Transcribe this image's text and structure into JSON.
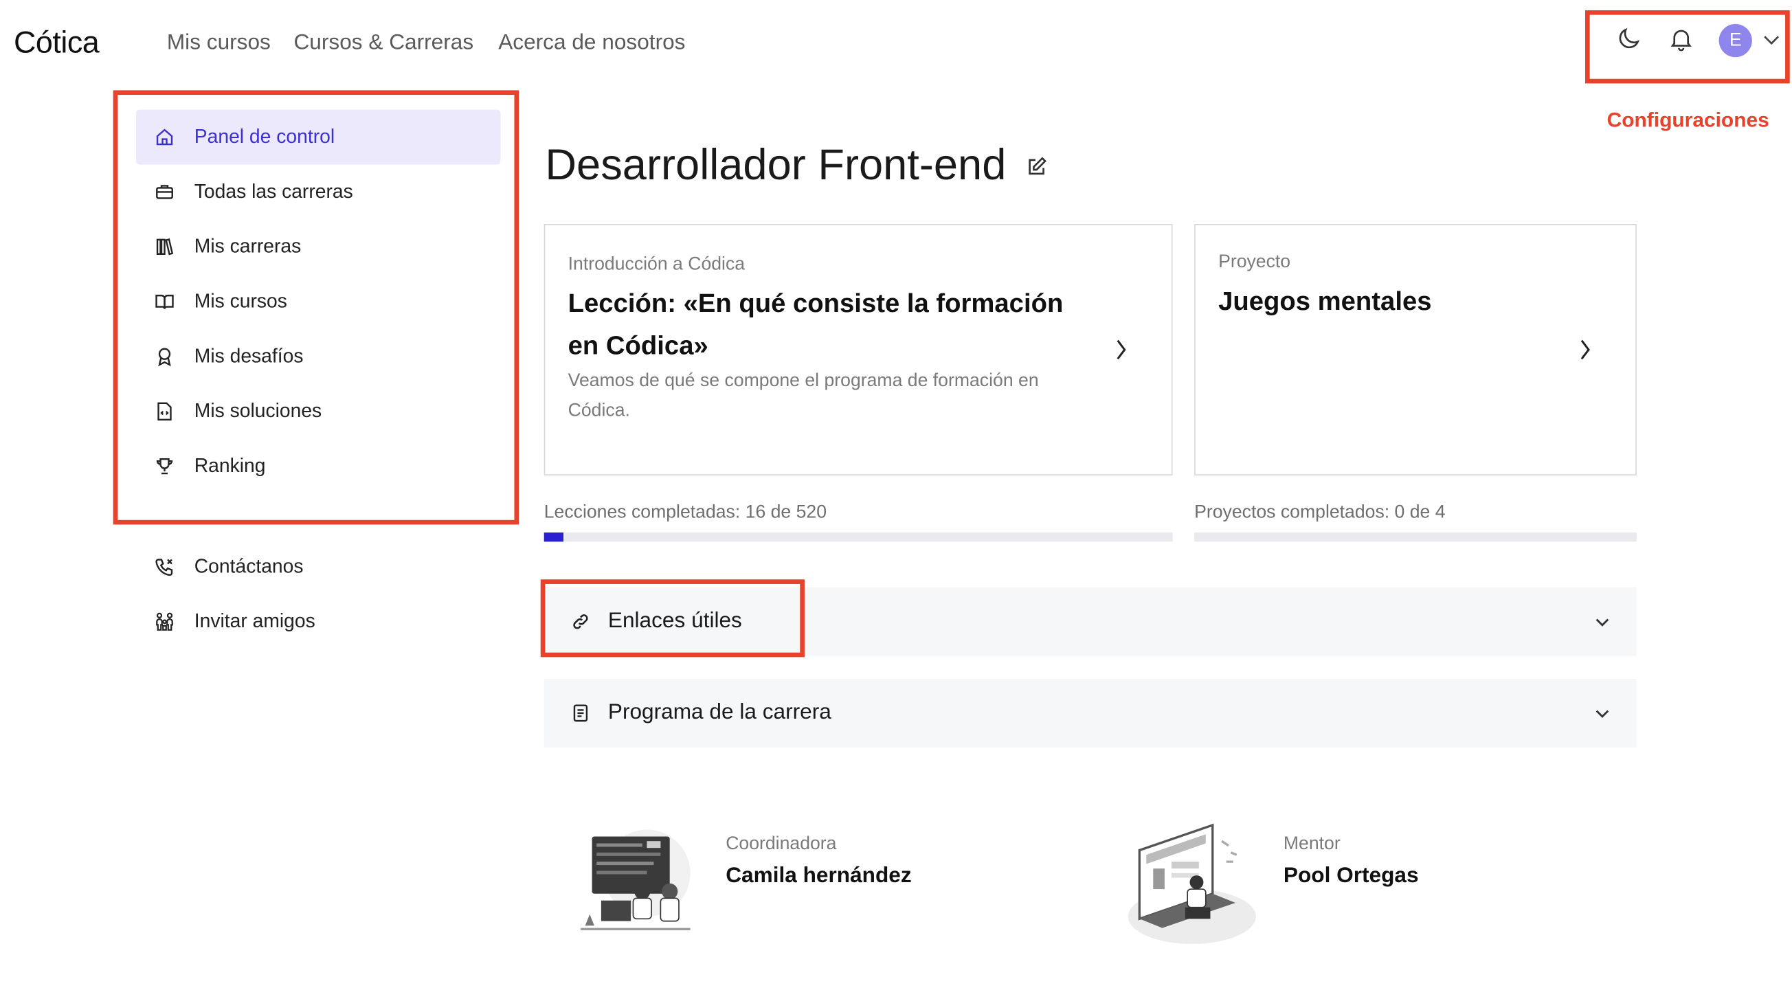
{
  "header": {
    "logo": "Cótica",
    "nav": [
      "Mis cursos",
      "Cursos & Carreras",
      "Acerca de nosotros"
    ],
    "avatar_letter": "E",
    "config_label": "Configuraciones"
  },
  "sidebar": {
    "items": [
      {
        "label": "Panel de control",
        "icon": "home-icon"
      },
      {
        "label": "Todas las carreras",
        "icon": "briefcase-icon"
      },
      {
        "label": "Mis carreras",
        "icon": "books-icon"
      },
      {
        "label": "Mis cursos",
        "icon": "book-open-icon"
      },
      {
        "label": "Mis desafíos",
        "icon": "award-icon"
      },
      {
        "label": "Mis soluciones",
        "icon": "file-code-icon"
      },
      {
        "label": "Ranking",
        "icon": "trophy-icon"
      }
    ],
    "extra": [
      {
        "label": "Contáctanos",
        "icon": "phone-icon"
      },
      {
        "label": "Invitar amigos",
        "icon": "people-icon"
      }
    ]
  },
  "main": {
    "title": "Desarrollador Front-end",
    "lesson_card": {
      "subtitle": "Introducción a Códica",
      "title_line1": "Lección: «En qué consiste la formación",
      "title_line2": "en Códica»",
      "desc_line1": "Veamos de qué se compone el programa de formación en",
      "desc_line2": "Códica."
    },
    "project_card": {
      "subtitle": "Proyecto",
      "title": "Juegos mentales"
    },
    "lessons_progress": {
      "label": "Lecciones completadas: 16 de 520",
      "done": 16,
      "total": 520
    },
    "projects_progress": {
      "label": "Proyectos completados: 0 de 4",
      "done": 0,
      "total": 4
    },
    "accordions": [
      {
        "label": "Enlaces útiles",
        "icon": "link-icon"
      },
      {
        "label": "Programa de la carrera",
        "icon": "document-icon"
      }
    ],
    "people": [
      {
        "role": "Coordinadora",
        "name": "Camila hernández"
      },
      {
        "role": "Mentor",
        "name": "Pool Ortegas"
      }
    ]
  },
  "colors": {
    "accent": "#3b2fd6",
    "highlight": "#e8412c",
    "active_bg": "#ebe9fb",
    "avatar": "#8e86ec"
  }
}
